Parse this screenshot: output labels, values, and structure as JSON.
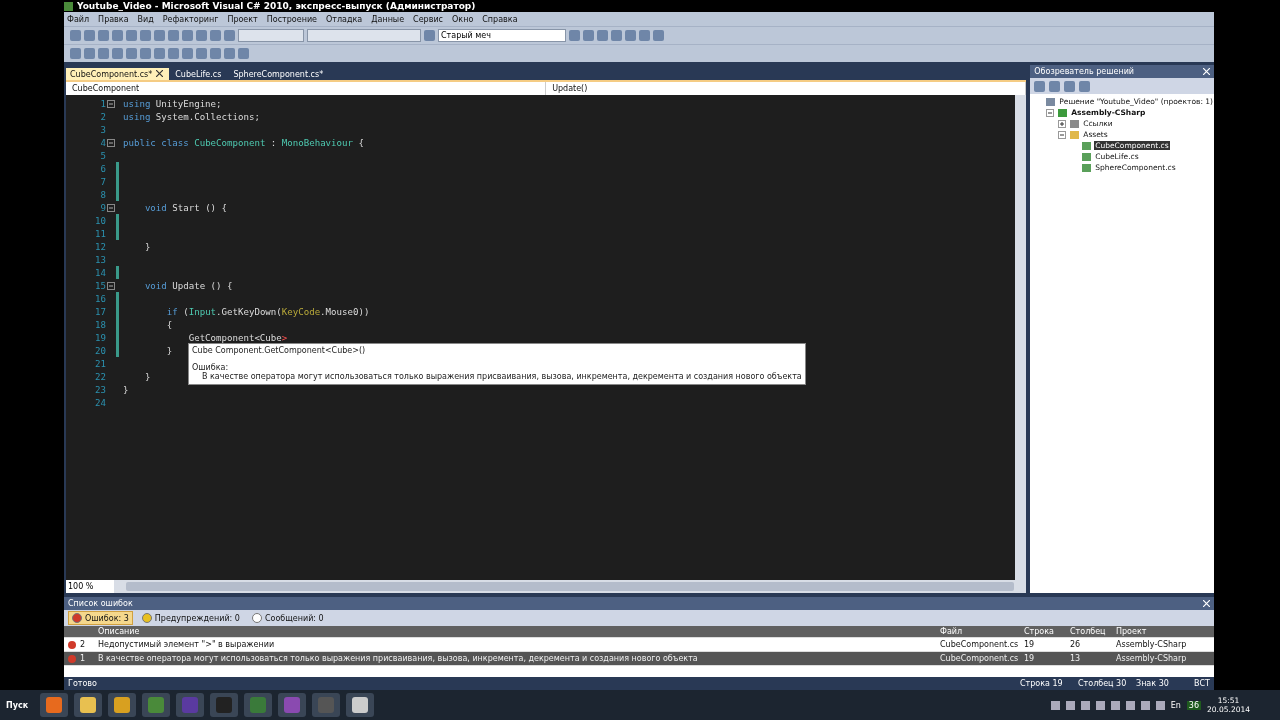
{
  "window": {
    "title": "Youtube_Video - Microsoft Visual C# 2010, экспресс-выпуск (Администратор)"
  },
  "menu": [
    "Файл",
    "Правка",
    "Вид",
    "Рефакторинг",
    "Проект",
    "Построение",
    "Отладка",
    "Данные",
    "Сервис",
    "Окно",
    "Справка"
  ],
  "toolbar": {
    "target_combo": "Старый меч"
  },
  "tabs": [
    {
      "label": "CubeComponent.cs*",
      "selected": true
    },
    {
      "label": "CubeLife.cs",
      "selected": false
    },
    {
      "label": "SphereComponent.cs*",
      "selected": false
    }
  ],
  "nav": {
    "type": "CubeComponent",
    "member": "Update()"
  },
  "code_lines": [
    {
      "n": "1",
      "fold": true,
      "changed": false,
      "tokens": [
        {
          "t": "using",
          "kind": "kw"
        },
        {
          "t": " UnityEngine;",
          "kind": "plain"
        }
      ]
    },
    {
      "n": "2",
      "fold": false,
      "changed": false,
      "tokens": [
        {
          "t": "using",
          "kind": "kw"
        },
        {
          "t": " System.Collections;",
          "kind": "plain"
        }
      ]
    },
    {
      "n": "3",
      "fold": false,
      "changed": false
    },
    {
      "n": "4",
      "fold": true,
      "changed": false,
      "tokens": [
        {
          "t": "public class ",
          "kind": "kw"
        },
        {
          "t": "CubeComponent",
          "kind": "type"
        },
        {
          "t": " : ",
          "kind": "plain"
        },
        {
          "t": "MonoBehaviour",
          "kind": "type"
        },
        {
          "t": " {",
          "kind": "plain"
        }
      ]
    },
    {
      "n": "5",
      "fold": false,
      "changed": false
    },
    {
      "n": "6",
      "fold": false,
      "changed": true
    },
    {
      "n": "7",
      "fold": false,
      "changed": true
    },
    {
      "n": "8",
      "fold": false,
      "changed": true
    },
    {
      "n": "9",
      "fold": true,
      "changed": false,
      "tokens": [
        {
          "t": "    void",
          "kind": "kw"
        },
        {
          "t": " Start () {",
          "kind": "plain"
        }
      ]
    },
    {
      "n": "10",
      "fold": false,
      "changed": true
    },
    {
      "n": "11",
      "fold": false,
      "changed": true
    },
    {
      "n": "12",
      "fold": false,
      "changed": false,
      "tokens": [
        {
          "t": "    }",
          "kind": "plain"
        }
      ]
    },
    {
      "n": "13",
      "fold": false,
      "changed": false
    },
    {
      "n": "14",
      "fold": false,
      "changed": true
    },
    {
      "n": "15",
      "fold": true,
      "changed": false,
      "tokens": [
        {
          "t": "    void",
          "kind": "kw"
        },
        {
          "t": " Update () {",
          "kind": "plain"
        }
      ]
    },
    {
      "n": "16",
      "fold": false,
      "changed": true
    },
    {
      "n": "17",
      "fold": false,
      "changed": true,
      "tokens": [
        {
          "t": "        if",
          "kind": "kw"
        },
        {
          "t": " (",
          "kind": "plain"
        },
        {
          "t": "Input",
          "kind": "type"
        },
        {
          "t": ".GetKeyDown(",
          "kind": "plain"
        },
        {
          "t": "KeyCode",
          "kind": "enum"
        },
        {
          "t": ".Mouse0))",
          "kind": "plain"
        }
      ]
    },
    {
      "n": "18",
      "fold": false,
      "changed": true,
      "tokens": [
        {
          "t": "        {",
          "kind": "plain"
        }
      ]
    },
    {
      "n": "19",
      "fold": false,
      "changed": true,
      "tokens": [
        {
          "t": "            GetComponent<Cube",
          "kind": "plain"
        },
        {
          "t": ">",
          "kind": "error"
        }
      ]
    },
    {
      "n": "20",
      "fold": false,
      "changed": true,
      "tokens": [
        {
          "t": "        }",
          "kind": "plain"
        }
      ]
    },
    {
      "n": "21",
      "fold": false,
      "changed": false
    },
    {
      "n": "22",
      "fold": false,
      "changed": false,
      "tokens": [
        {
          "t": "    }",
          "kind": "plain"
        }
      ]
    },
    {
      "n": "23",
      "fold": false,
      "changed": false,
      "tokens": [
        {
          "t": "}",
          "kind": "plain"
        }
      ]
    },
    {
      "n": "24",
      "fold": false,
      "changed": false
    }
  ],
  "tooltip": {
    "signature": "Cube Component.GetComponent<Cube>()",
    "heading": "Ошибка:",
    "message": "В качестве оператора могут использоваться только выражения присваивания, вызова, инкремента, декремента и создания нового объекта"
  },
  "zoom": "100 %",
  "solution_explorer": {
    "title": "Обозреватель решений",
    "tree": [
      {
        "label": "Решение \"Youtube_Video\" (проектов: 1)",
        "kind": "solution",
        "selected": false,
        "children": [
          {
            "label": "Assembly-CSharp",
            "kind": "project",
            "expanded": true,
            "selected": false,
            "children": [
              {
                "label": "Ссылки",
                "kind": "references",
                "expanded": false,
                "selected": false
              },
              {
                "label": "Assets",
                "kind": "folder",
                "expanded": true,
                "selected": false,
                "children": [
                  {
                    "label": "CubeComponent.cs",
                    "kind": "file",
                    "selected": true
                  },
                  {
                    "label": "CubeLife.cs",
                    "kind": "file",
                    "selected": false
                  },
                  {
                    "label": "SphereComponent.cs",
                    "kind": "file",
                    "selected": false
                  }
                ]
              }
            ]
          }
        ]
      }
    ]
  },
  "error_list": {
    "title": "Список ошибок",
    "filters": [
      {
        "label": "Ошибок: 3",
        "kind": "error",
        "selected": true
      },
      {
        "label": "Предупреждений: 0",
        "kind": "warning",
        "selected": false
      },
      {
        "label": "Сообщений: 0",
        "kind": "info",
        "selected": false
      }
    ],
    "columns": [
      "Описание",
      "Файл",
      "Строка",
      "Столбец",
      "Проект"
    ],
    "rows": [
      {
        "n": "2",
        "description": "Недопустимый элемент \">\" в выражении",
        "file": "CubeComponent.cs",
        "line": "19",
        "column": "26",
        "project": "Assembly-CSharp",
        "selected": false
      },
      {
        "n": "1",
        "description": "В качестве оператора могут использоваться только выражения присваивания, вызова, инкремента, декремента и создания нового объекта",
        "file": "CubeComponent.cs",
        "line": "19",
        "column": "13",
        "project": "Assembly-CSharp",
        "selected": true
      }
    ]
  },
  "status_bar": {
    "state": "Готово",
    "line": "Строка 19",
    "column": "Столбец 30",
    "char": "Знак 30",
    "mode": "ВСТ"
  },
  "taskbar": {
    "start": "Пуск",
    "tray_lang": "En",
    "tray_badge": "36",
    "time": "15:51",
    "date": "20.05.2014"
  }
}
